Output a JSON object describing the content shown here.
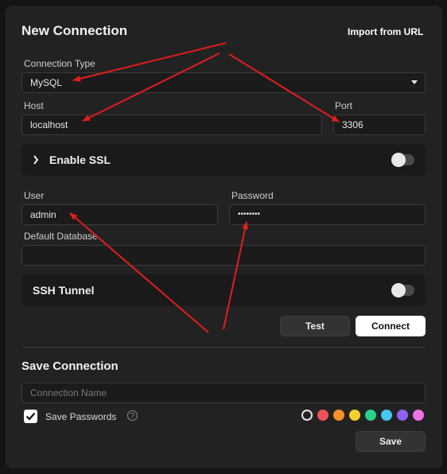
{
  "header": {
    "title": "New Connection",
    "import_label": "Import from URL"
  },
  "connection_type": {
    "label": "Connection Type",
    "value": "MySQL"
  },
  "host": {
    "label": "Host",
    "value": "localhost"
  },
  "port": {
    "label": "Port",
    "value": "3306"
  },
  "ssl": {
    "label": "Enable SSL",
    "enabled": false
  },
  "user": {
    "label": "User",
    "value": "admin"
  },
  "password": {
    "label": "Password",
    "value": "••••••••"
  },
  "default_database": {
    "label": "Default Database",
    "value": ""
  },
  "ssh": {
    "label": "SSH Tunnel",
    "enabled": false
  },
  "actions": {
    "test_label": "Test",
    "connect_label": "Connect"
  },
  "save_section": {
    "title": "Save Connection",
    "name_placeholder": "Connection Name",
    "save_passwords_label": "Save Passwords",
    "save_passwords_checked": true,
    "help_glyph": "?",
    "save_label": "Save",
    "colors": [
      "none",
      "#f0525a",
      "#f7912a",
      "#f2d12e",
      "#2bd18a",
      "#45c7ee",
      "#9061f2",
      "#ef71e6"
    ]
  },
  "annotation_color": "#e11d1d"
}
